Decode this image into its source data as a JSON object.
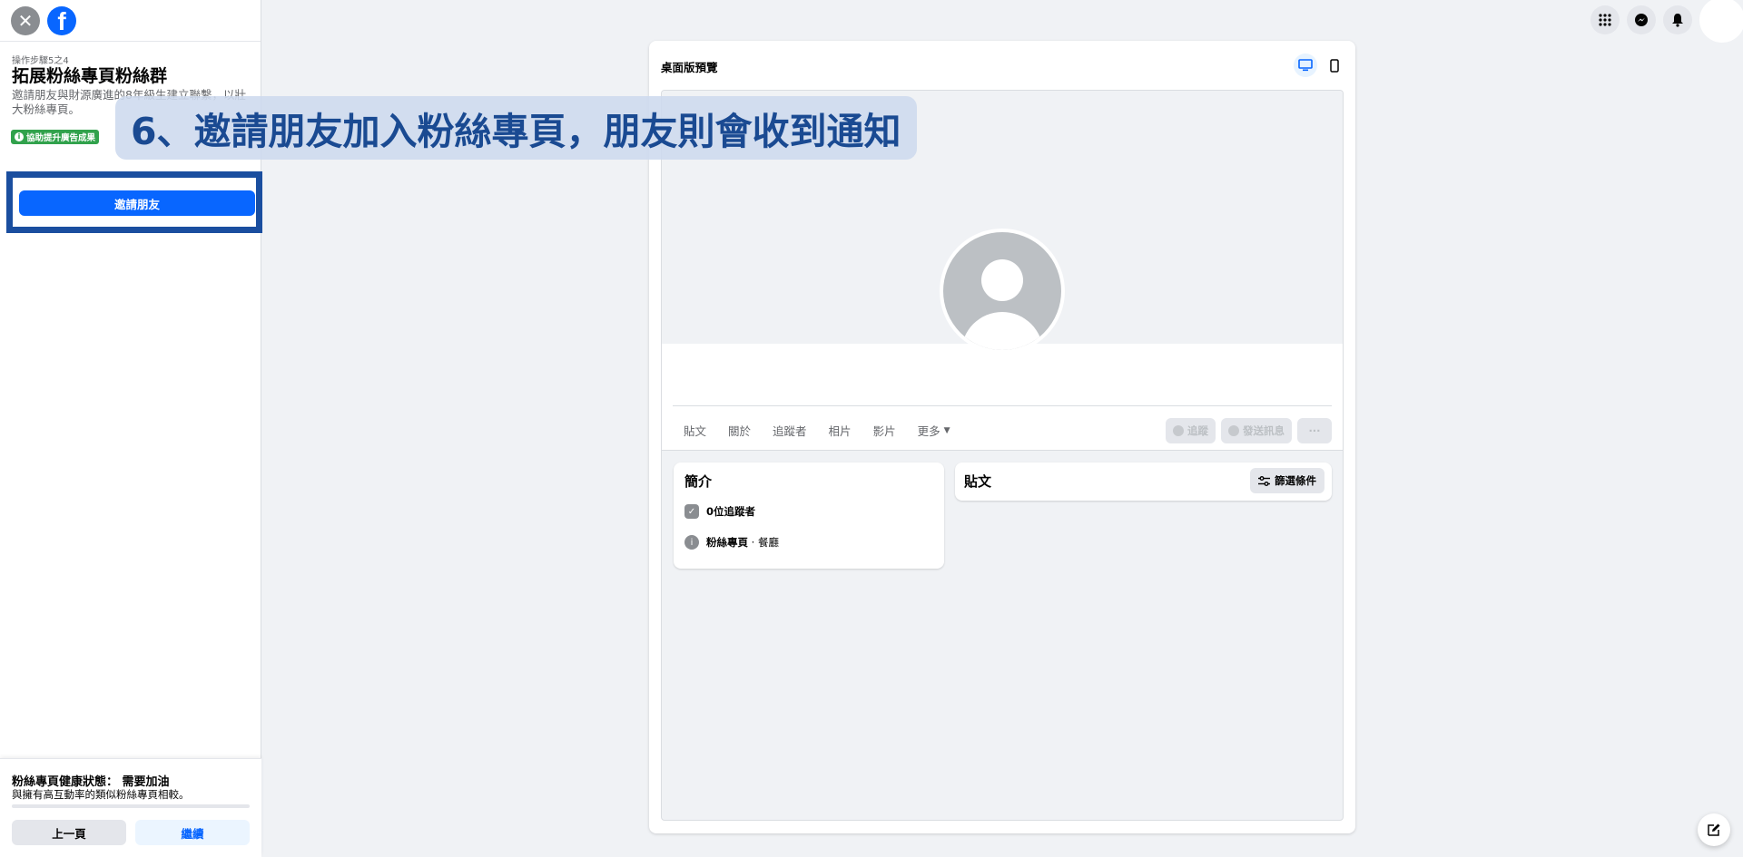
{
  "left_panel": {
    "close_icon": "close-icon",
    "logo_icon": "facebook-logo-icon",
    "logo_text": "f",
    "step": "操作步驟5之4",
    "title": "拓展粉絲專頁粉絲群",
    "description": "邀請朋友與財源廣進的8年級生建立聯繫，以壯大粉絲專頁。",
    "badge": "協助提升廣告成果",
    "invite_button": "邀請朋友",
    "health_title": "粉絲專頁健康狀態： 需要加油",
    "health_subtitle": "與擁有高互動率的類似粉絲專頁相較。",
    "prev_button": "上一頁",
    "next_button": "繼續"
  },
  "caption": "6、邀請朋友加入粉絲專頁，朋友則會收到通知",
  "top_icons": [
    "menu-grid-icon",
    "messenger-icon",
    "notifications-bell-icon"
  ],
  "preview": {
    "title": "桌面版預覽",
    "tabs": [
      {
        "label": "貼文"
      },
      {
        "label": "關於"
      },
      {
        "label": "追蹤者"
      },
      {
        "label": "相片"
      },
      {
        "label": "影片"
      },
      {
        "label": "更多"
      }
    ],
    "actions": {
      "follow": "追蹤",
      "message": "發送訊息",
      "more": "···"
    },
    "intro": {
      "title": "簡介",
      "followers": "0位追蹤者",
      "category_prefix": "粉絲專頁",
      "category": " · 餐廳"
    },
    "posts": {
      "title": "貼文",
      "filter": "篩選條件"
    }
  }
}
